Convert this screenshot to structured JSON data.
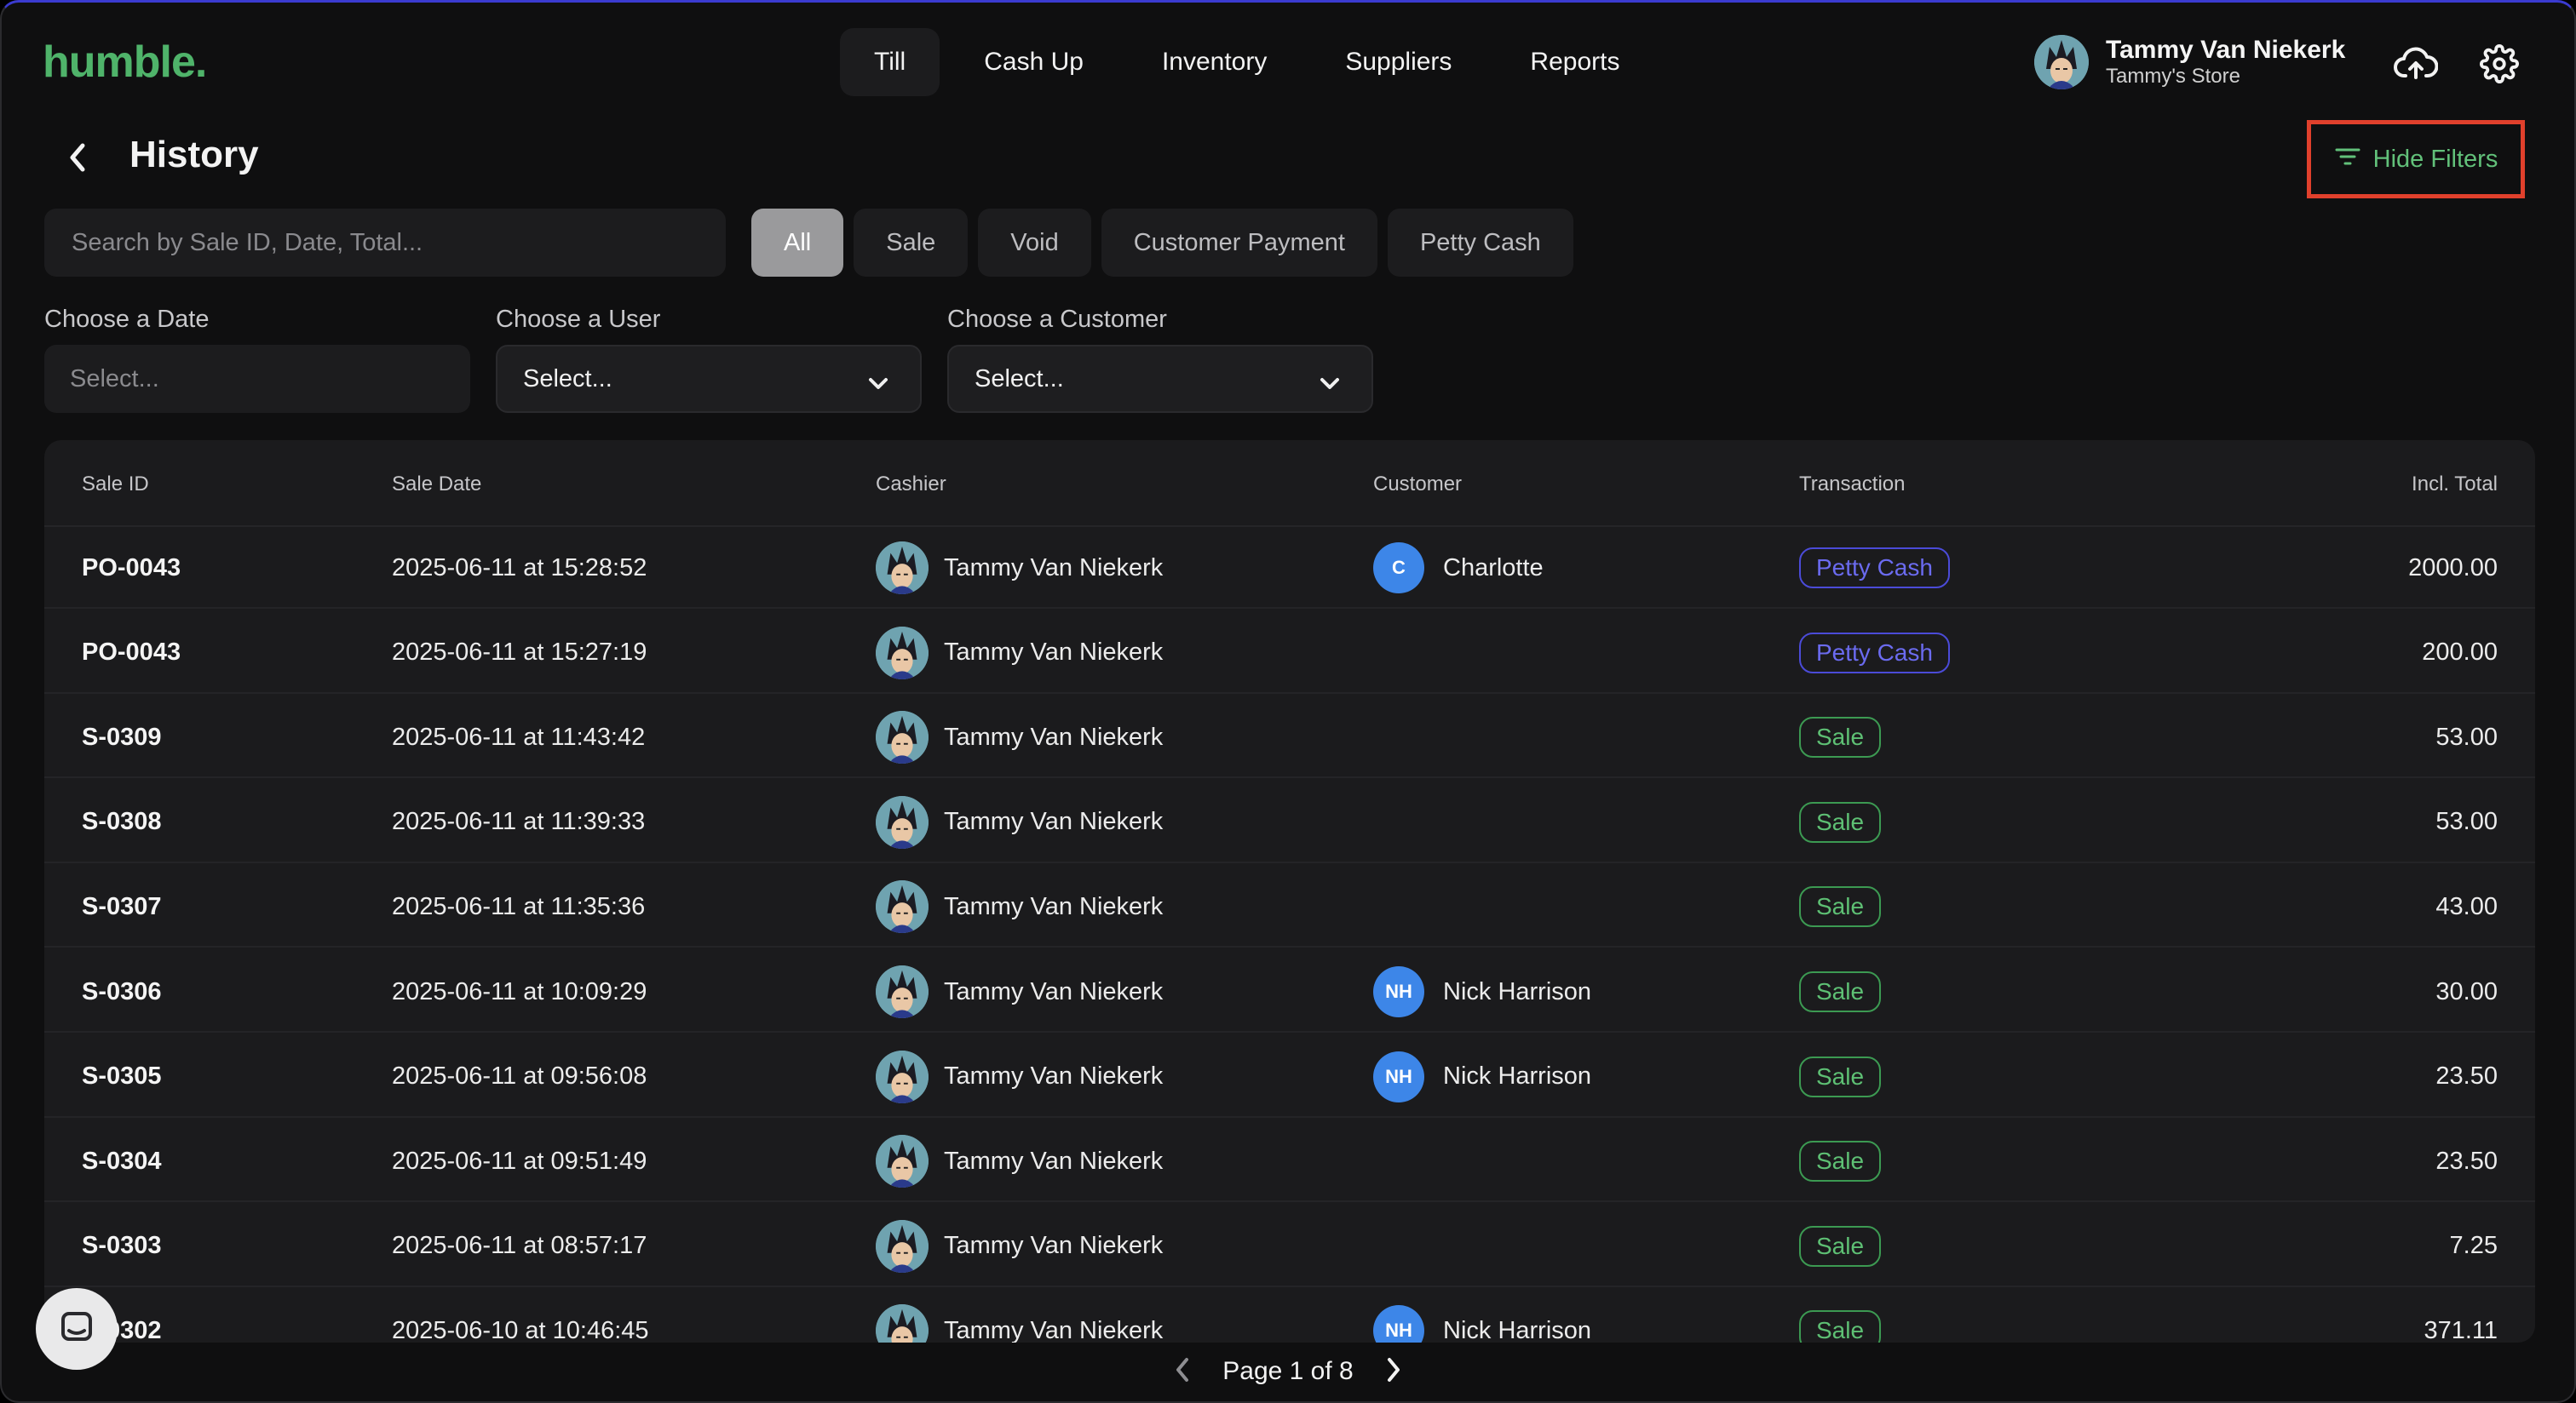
{
  "app": {
    "logo": "humble."
  },
  "nav": {
    "items": [
      {
        "label": "Till",
        "active": true
      },
      {
        "label": "Cash Up"
      },
      {
        "label": "Inventory"
      },
      {
        "label": "Suppliers"
      },
      {
        "label": "Reports"
      }
    ]
  },
  "user": {
    "name": "Tammy Van Niekerk",
    "store": "Tammy's Store"
  },
  "icons": {
    "sync": "cloud-upload-icon",
    "settings": "gear-icon",
    "back": "chevron-left-icon",
    "filter": "filter-lines-icon"
  },
  "page": {
    "title": "History",
    "hide_filters": "Hide Filters"
  },
  "search": {
    "placeholder": "Search by Sale ID, Date, Total..."
  },
  "chips": [
    "All",
    "Sale",
    "Void",
    "Customer Payment",
    "Petty Cash"
  ],
  "filters": {
    "date_label": "Choose a Date",
    "date_placeholder": "Select...",
    "user_label": "Choose a User",
    "user_value": "Select...",
    "customer_label": "Choose a Customer",
    "customer_value": "Select..."
  },
  "table": {
    "headers": [
      "Sale ID",
      "Sale Date",
      "Cashier",
      "Customer",
      "Transaction",
      "Incl. Total"
    ],
    "rows": [
      {
        "id": "PO-0043",
        "date": "2025-06-11 at 15:28:52",
        "cashier": "Tammy Van Niekerk",
        "customer_initials": "C",
        "customer": "Charlotte",
        "type": "Petty Cash",
        "total": "2000.00"
      },
      {
        "id": "PO-0043",
        "date": "2025-06-11 at 15:27:19",
        "cashier": "Tammy Van Niekerk",
        "customer_initials": "",
        "customer": "",
        "type": "Petty Cash",
        "total": "200.00"
      },
      {
        "id": "S-0309",
        "date": "2025-06-11 at 11:43:42",
        "cashier": "Tammy Van Niekerk",
        "customer_initials": "",
        "customer": "",
        "type": "Sale",
        "total": "53.00"
      },
      {
        "id": "S-0308",
        "date": "2025-06-11 at 11:39:33",
        "cashier": "Tammy Van Niekerk",
        "customer_initials": "",
        "customer": "",
        "type": "Sale",
        "total": "53.00"
      },
      {
        "id": "S-0307",
        "date": "2025-06-11 at 11:35:36",
        "cashier": "Tammy Van Niekerk",
        "customer_initials": "",
        "customer": "",
        "type": "Sale",
        "total": "43.00"
      },
      {
        "id": "S-0306",
        "date": "2025-06-11 at 10:09:29",
        "cashier": "Tammy Van Niekerk",
        "customer_initials": "NH",
        "customer": "Nick Harrison",
        "type": "Sale",
        "total": "30.00"
      },
      {
        "id": "S-0305",
        "date": "2025-06-11 at 09:56:08",
        "cashier": "Tammy Van Niekerk",
        "customer_initials": "NH",
        "customer": "Nick Harrison",
        "type": "Sale",
        "total": "23.50"
      },
      {
        "id": "S-0304",
        "date": "2025-06-11 at 09:51:49",
        "cashier": "Tammy Van Niekerk",
        "customer_initials": "",
        "customer": "",
        "type": "Sale",
        "total": "23.50"
      },
      {
        "id": "S-0303",
        "date": "2025-06-11 at 08:57:17",
        "cashier": "Tammy Van Niekerk",
        "customer_initials": "",
        "customer": "",
        "type": "Sale",
        "total": "7.25"
      },
      {
        "id": "S-0302",
        "date": "2025-06-10 at 10:46:45",
        "cashier": "Tammy Van Niekerk",
        "customer_initials": "NH",
        "customer": "Nick Harrison",
        "type": "Sale",
        "total": "371.11"
      }
    ]
  },
  "pagination": {
    "text": "Page 1 of 8"
  },
  "colors": {
    "brand": "#4fb36a",
    "accent_green": "#62c17a",
    "petty_cash": "#6b6bf0",
    "highlight": "#e0402c",
    "customer_avatar": "#3d86e8"
  }
}
